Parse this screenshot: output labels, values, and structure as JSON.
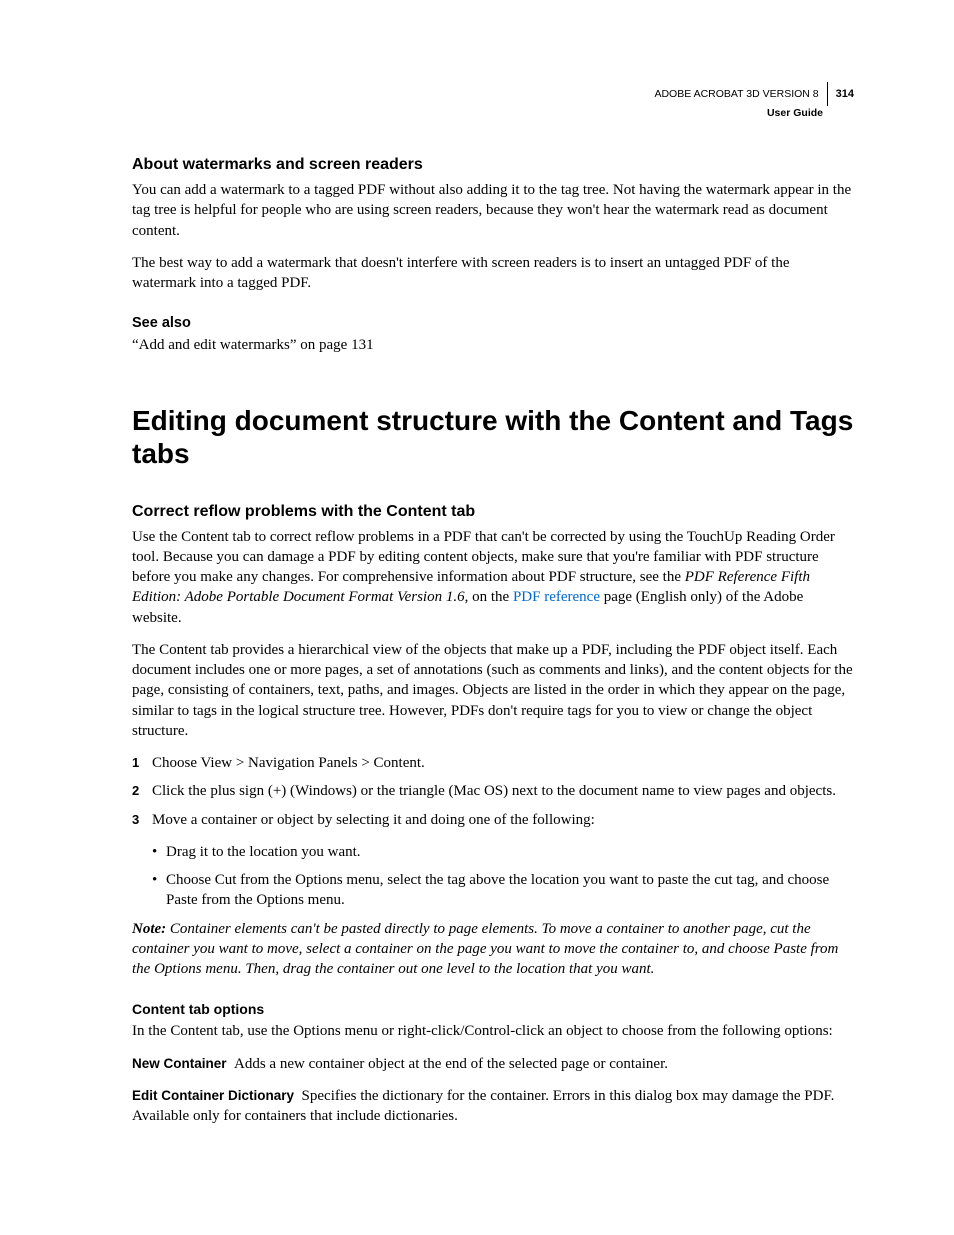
{
  "header": {
    "product": "ADOBE ACROBAT 3D VERSION 8",
    "page_number": "314",
    "subtitle": "User Guide"
  },
  "section1": {
    "heading": "About watermarks and screen readers",
    "p1": "You can add a watermark to a tagged PDF without also adding it to the tag tree. Not having the watermark appear in the tag tree is helpful for people who are using screen readers, because they won't hear the watermark read as document content.",
    "p2": "The best way to add a watermark that doesn't interfere with screen readers is to insert an untagged PDF of the watermark into a tagged PDF.",
    "see_also_heading": "See also",
    "see_also_text": "“Add and edit watermarks” on page 131"
  },
  "main_heading": "Editing document structure with the Content and Tags tabs",
  "section2": {
    "heading": "Correct reflow problems with the Content tab",
    "p1_a": "Use the Content tab to correct reflow problems in a PDF that can't be corrected by using the TouchUp Reading Order tool. Because you can damage a PDF by editing content objects, make sure that you're familiar with PDF structure before you make any changes. For comprehensive information about PDF structure, see the ",
    "p1_ref": "PDF Reference Fifth Edition: Adobe Portable Document Format Version 1.6",
    "p1_b": ", on the ",
    "p1_link": "PDF reference",
    "p1_c": " page (English only) of the Adobe website.",
    "p2": "The Content tab provides a hierarchical view of the objects that make up a PDF, including the PDF object itself. Each document includes one or more pages, a set of annotations (such as comments and links), and the content objects for the page, consisting of containers, text, paths, and images. Objects are listed in the order in which they appear on the page, similar to tags in the logical structure tree. However, PDFs don't require tags for you to view or change the object structure.",
    "steps": [
      "Choose View > Navigation Panels > Content.",
      "Click the plus sign (+) (Windows) or the triangle (Mac OS) next to the document name to view pages and objects.",
      "Move a container or object by selecting it and doing one of the following:"
    ],
    "bullets": [
      "Drag it to the location you want.",
      "Choose Cut from the Options menu, select the tag above the location you want to paste the cut tag, and choose Paste from the Options menu."
    ],
    "note_label": "Note:",
    "note_text": " Container elements can't be pasted directly to page elements. To move a container to another page, cut the container you want to move, select a container on the page you want to move the container to, and choose Paste from the Options menu. Then, drag the container out one level to the location that you want."
  },
  "section3": {
    "heading": "Content tab options",
    "intro": "In the Content tab, use the Options menu or right-click/Control-click an object to choose from the following options:",
    "defs": [
      {
        "term": "New Container",
        "text": "Adds a new container object at the end of the selected page or container."
      },
      {
        "term": "Edit Container Dictionary",
        "text": "Specifies the dictionary for the container. Errors in this dialog box may damage the PDF. Available only for containers that include dictionaries."
      }
    ]
  }
}
